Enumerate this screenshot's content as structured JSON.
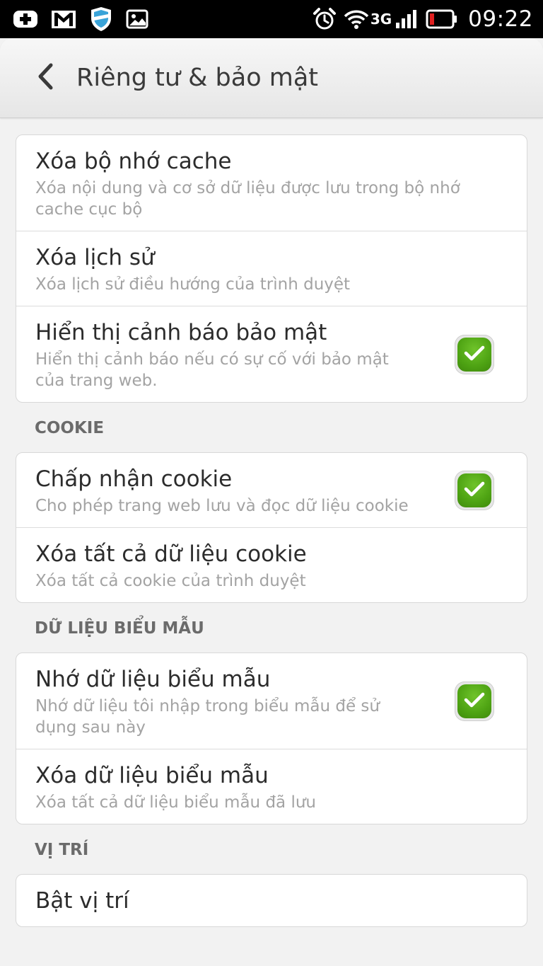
{
  "status_bar": {
    "time": "09:22",
    "network": "3G",
    "left_icons": [
      "add-box-icon",
      "gmail-icon",
      "shield-icon",
      "image-icon"
    ],
    "right_icons": [
      "alarm-icon",
      "wifi-icon",
      "signal-icon",
      "battery-low-icon"
    ]
  },
  "header": {
    "title": "Riêng tư & bảo mật",
    "back_icon": "chevron-left-icon"
  },
  "groups": [
    {
      "items": [
        {
          "title": "Xóa bộ nhớ cache",
          "subtitle": "Xóa nội dung và cơ sở dữ liệu được lưu trong bộ nhớ cache cục bộ"
        },
        {
          "title": "Xóa lịch sử",
          "subtitle": "Xóa lịch sử điều hướng của trình duyệt"
        },
        {
          "title": "Hiển thị cảnh báo bảo mật",
          "subtitle": "Hiển thị cảnh báo nếu có sự cố với bảo mật của trang web.",
          "checked": true
        }
      ]
    },
    {
      "header": "COOKIE",
      "items": [
        {
          "title": "Chấp nhận cookie",
          "subtitle": "Cho phép trang web lưu và đọc dữ liệu cookie",
          "checked": true
        },
        {
          "title": "Xóa tất cả dữ liệu cookie",
          "subtitle": "Xóa tất cả cookie của trình duyệt"
        }
      ]
    },
    {
      "header": "DỮ LIỆU BIỂU MẪU",
      "items": [
        {
          "title": "Nhớ dữ liệu biểu mẫu",
          "subtitle": "Nhớ dữ liệu tôi nhập trong biểu mẫu để sử dụng sau này",
          "checked": true
        },
        {
          "title": "Xóa dữ liệu biểu mẫu",
          "subtitle": "Xóa tất cả dữ liệu biểu mẫu đã lưu"
        }
      ]
    },
    {
      "header": "VỊ TRÍ",
      "items": [
        {
          "title": "Bật vị trí"
        }
      ]
    }
  ],
  "colors": {
    "accent_check": "#4ea313",
    "background": "#f2f2f2",
    "status_bar": "#000000",
    "battery_low": "#e02020"
  }
}
